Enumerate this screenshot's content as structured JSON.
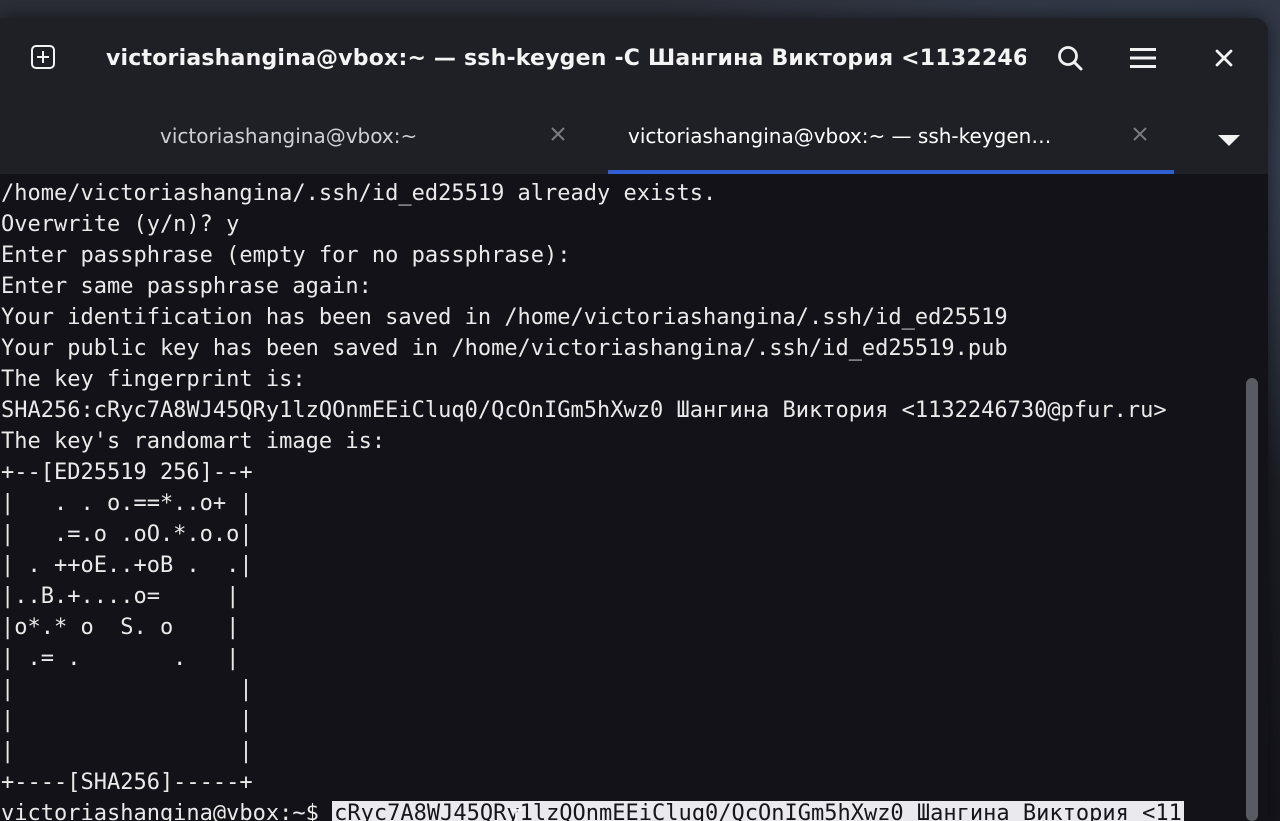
{
  "window": {
    "title": "victoriashangina@vbox:~ — ssh-keygen -C Шангина Виктория <1132246…"
  },
  "header": {
    "new_tab_icon": "new-tab-icon",
    "search_icon": "search-icon",
    "menu_icon": "hamburger-menu-icon",
    "close_icon": "close-icon"
  },
  "tabs": [
    {
      "label": "victoriashangina@vbox:~",
      "active": false
    },
    {
      "label": "victoriashangina@vbox:~ — ssh-keygen…",
      "active": true
    }
  ],
  "terminal": {
    "lines": [
      "/home/victoriashangina/.ssh/id_ed25519 already exists.",
      "Overwrite (y/n)? y",
      "Enter passphrase (empty for no passphrase):",
      "Enter same passphrase again:",
      "Your identification has been saved in /home/victoriashangina/.ssh/id_ed25519",
      "Your public key has been saved in /home/victoriashangina/.ssh/id_ed25519.pub",
      "The key fingerprint is:",
      "SHA256:cRyc7A8WJ45QRy1lzQOnmEEiCluq0/QcOnIGm5hXwz0 Шангина Виктория <1132246730@pfur.ru>",
      "The key's randomart image is:",
      "+--[ED25519 256]--+",
      "|   . . o.==*..o+ |",
      "|   .=.o .oO.*.o.o|",
      "| . ++oE..+oB .  .|",
      "|..B.+....o=     |",
      "|o*.* o  S. o    |",
      "| .= .       .   |",
      "|                 |",
      "|                 |",
      "|                 |",
      "+----[SHA256]-----+"
    ],
    "prompt": "victoriashangina@vbox:~$ ",
    "selected_input": "cRyc7A8WJ45QRy1lzQOnmEEiCluq0/QcOnIGm5hXwz0 Шангина Виктория <11"
  },
  "colors": {
    "terminal_bg": "#121218",
    "header_bg": "#1f1f26",
    "active_tab_underline": "#2f5fd0",
    "text": "#eaeaea"
  }
}
